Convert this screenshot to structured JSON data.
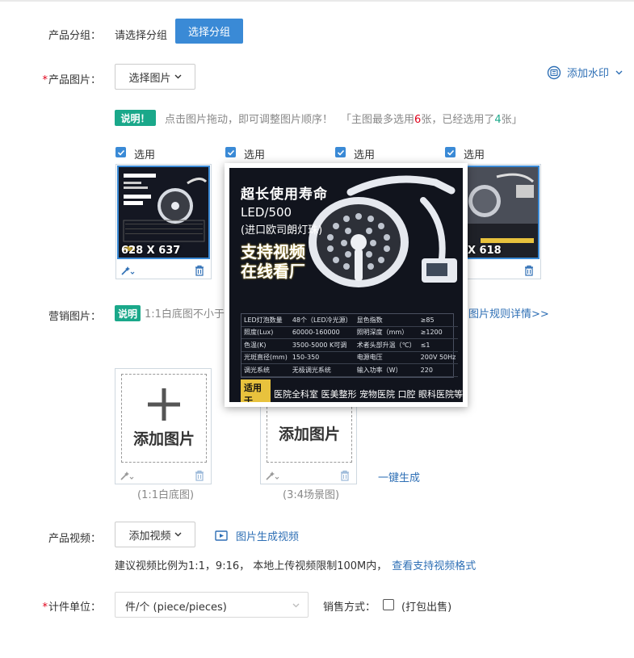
{
  "group": {
    "label": "产品分组：",
    "placeholder": "请选择分组",
    "button": "选择分组"
  },
  "images": {
    "required_mark": "*",
    "label": "产品图片：",
    "choose_button": "选择图片",
    "watermark": "添加水印",
    "note_badge": "说明！",
    "note_text": "点击图片拖动，即可调整图片顺序！",
    "note_bracket_open": "「主图最多选用",
    "note_max": "6",
    "note_mid": "张，已经选用了",
    "note_used": "4",
    "note_end": "张」",
    "select_label": "选用",
    "thumbs": [
      {
        "dim": "628 X 637"
      },
      {
        "dim": ""
      },
      {
        "dim": ""
      },
      {
        "dim": "X 618"
      }
    ]
  },
  "popup": {
    "title": "超长使用寿命",
    "model": "LED/500",
    "sub": "(进口欧司朗灯珠)",
    "slogan_1": "支持视频",
    "slogan_2": "在线看厂",
    "specs": [
      [
        "LED灯泡数量",
        "48个（LED冷光源）",
        "显色指数",
        "≥85"
      ],
      [
        "照度(Lux)",
        "60000-160000",
        "照明深度（mm）",
        "≥1200"
      ],
      [
        "色温(K)",
        "3500-5000 K可调",
        "术者头部升温（℃）",
        "≤1"
      ],
      [
        "光斑直径(mm)",
        "150-350",
        "电源电压",
        "200V 50Hz"
      ],
      [
        "调光系统",
        "无极调光系统",
        "输入功率（W）",
        "220"
      ]
    ],
    "use_tag": "适用于",
    "use_text": "医院全科室 医美整形 宠物医院 口腔 眼科医院等"
  },
  "marketing": {
    "label": "营销图片：",
    "badge": "说明",
    "text": "1:1白底图不小于8",
    "rule_link": "图片规则详情>>",
    "add_label": "添加图片",
    "white_caption": "(1:1白底图)",
    "scene_caption": "(3:4场景图)",
    "one_click": "一键生成"
  },
  "video": {
    "label": "产品视频：",
    "add_button": "添加视频",
    "gen_link": "图片生成视频",
    "hint": "建议视频比例为1:1，9:16， 本地上传视频限制100M内，",
    "format_link": "查看支持视频格式"
  },
  "unit": {
    "required_mark": "*",
    "label": "计件单位：",
    "value": "件/个 (piece/pieces)",
    "sale_label": "销售方式：",
    "sale_option": "(打包出售)"
  },
  "colors": {
    "primary": "#3a8ad6",
    "badge": "#1aa88a",
    "required": "#e0001a",
    "link": "#2e6fb5"
  }
}
